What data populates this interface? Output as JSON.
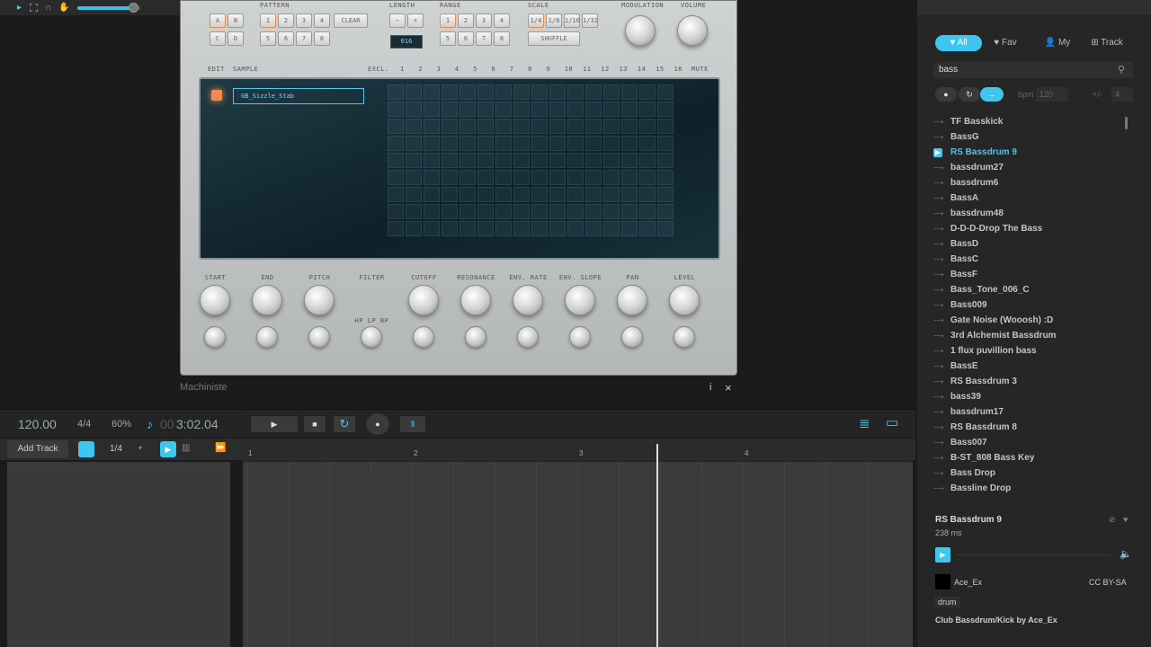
{
  "toolbar": {
    "icons": [
      "select-arrow-icon",
      "marquee-icon",
      "headphones-icon",
      "hand-icon"
    ],
    "volume": 0.9
  },
  "plugin": {
    "name": "Machiniste",
    "sections": {
      "pattern": "PATTERN",
      "length": "LENGTH",
      "range": "RANGE",
      "scale": "SCALE",
      "modulation": "MODULATION",
      "volume": "VOLUME",
      "clear": "CLEAR",
      "shuffle": "SHUFFLE",
      "length_value": "016",
      "pattern_buttons": [
        "1",
        "2",
        "3",
        "4",
        "5",
        "6",
        "7",
        "8"
      ],
      "ab": [
        "A",
        "B",
        "C",
        "D"
      ],
      "range_buttons": [
        "1",
        "2",
        "3",
        "4",
        "5",
        "6",
        "7",
        "8"
      ],
      "scale_buttons": [
        "1/4",
        "1/8",
        "1/16",
        "1/32"
      ],
      "length_buttons": [
        "−",
        "+"
      ]
    },
    "grid_header": {
      "edit": "EDIT",
      "sample": "SAMPLE",
      "excl": "EXCL.",
      "steps": [
        "1",
        "2",
        "3",
        "4",
        "5",
        "6",
        "7",
        "8",
        "9",
        "10",
        "11",
        "12",
        "13",
        "14",
        "15",
        "16"
      ],
      "mute": "MUTE"
    },
    "sample_name": "GB_Sizzle_Stab",
    "knobs": [
      "START",
      "END",
      "PITCH",
      "FILTER",
      "CUTOFF",
      "RESONANCE",
      "ENV. RATE",
      "ENV. SLOPE",
      "PAN",
      "LEVEL"
    ],
    "filter_modes": "HP LP BP",
    "info": "i",
    "close": "×"
  },
  "transport": {
    "tempo": "120.00",
    "signature": "4/4",
    "swing": "60%",
    "time_prefix": "00",
    "time": "3:02.04",
    "play": "▶",
    "stop": "■",
    "loop": "↻",
    "record": "●"
  },
  "tracks": {
    "add_track": "Add Track",
    "quantize": "1/4",
    "ruler": [
      "1",
      "2",
      "3",
      "4"
    ]
  },
  "browser": {
    "tabs": [
      {
        "label": "♥ All"
      },
      {
        "label": "♥ Fav"
      },
      {
        "label": "👤 My"
      },
      {
        "label": "⊞ Track"
      }
    ],
    "search": "bass",
    "bpm_label": "bpm",
    "bpm_value": "120",
    "pm_label": "+/-",
    "pm_value": "4",
    "results": [
      "TF Basskick",
      "BassG",
      "RS Bassdrum 9",
      "bassdrum27",
      "bassdrum6",
      "BassA",
      "bassdrum48",
      "D-D-D-Drop The Bass",
      "BassD",
      "BassC",
      "BassF",
      "Bass_Tone_006_C",
      "Bass009",
      "Gate Noise (Wooosh) :D",
      "3rd Alchemist Bassdrum",
      "1 flux puvillion bass",
      "BassE",
      "RS Bassdrum 3",
      "bass39",
      "bassdrum17",
      "RS Bassdrum 8",
      "Bass007",
      "B-ST_808 Bass Key",
      "Bass Drop",
      "Bassline Drop"
    ],
    "selected_index": 2,
    "detail": {
      "title": "RS Bassdrum 9",
      "duration": "238 ms",
      "author": "Ace_Ex",
      "license": "CC BY-SA",
      "tag": "drum",
      "description": "Club Bassdrum/Kick by Ace_Ex"
    },
    "accent": "#3fc6ef"
  }
}
